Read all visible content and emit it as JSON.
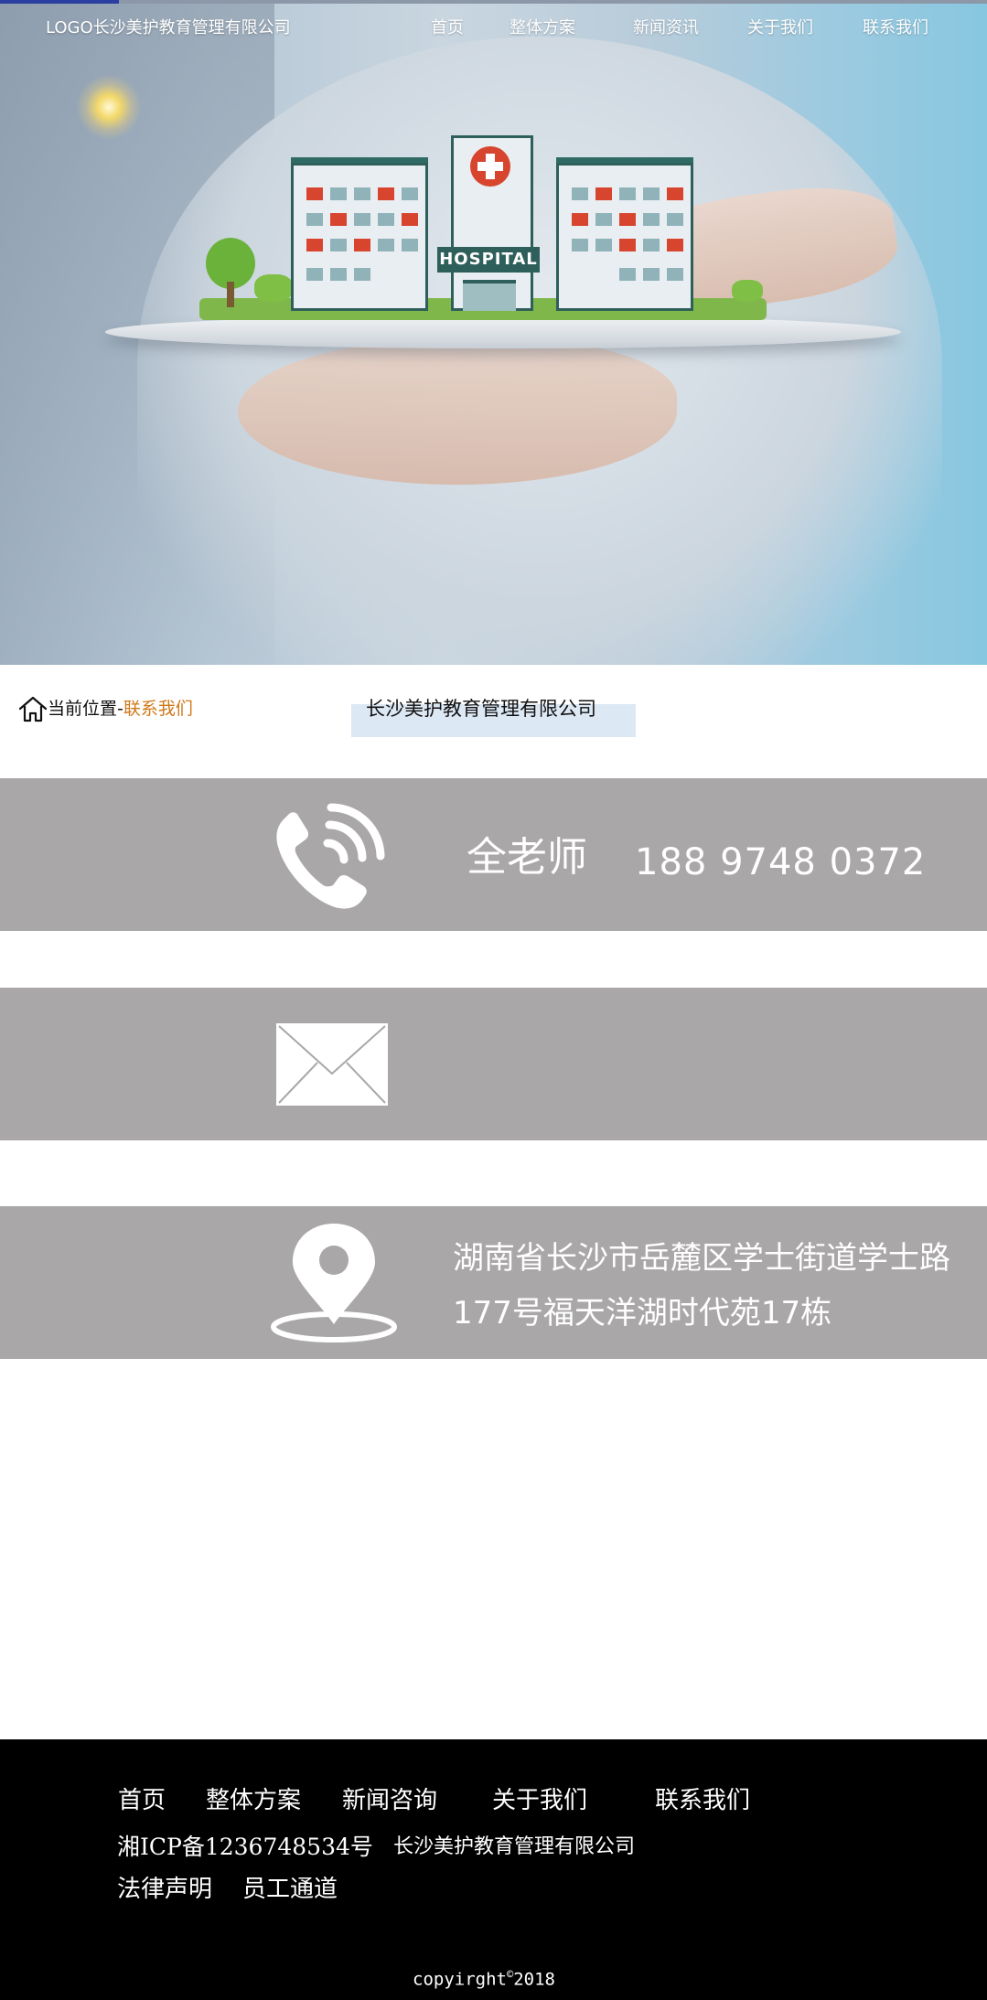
{
  "header": {
    "logo_text": "LOGO长沙美护教育管理有限公司",
    "nav": [
      "首页",
      "整体方案",
      "新闻资讯",
      "关于我们",
      "联系我们"
    ]
  },
  "hero": {
    "image_sign_text": "HOSPITAL"
  },
  "breadcrumb": {
    "prefix": "当前位置-",
    "current": "联系我们",
    "company_title": "长沙美护教育管理有限公司"
  },
  "contact": {
    "name": "全老师",
    "phone": "188 9748 0372",
    "address_line1": "湖南省长沙市岳麓区学士街道学士路",
    "address_line2": "177号福天洋湖时代苑17栋"
  },
  "footer": {
    "links": [
      "首页",
      "整体方案",
      "新闻咨询",
      "关于我们",
      "联系我们"
    ],
    "icp": "湘ICP备1236748534号",
    "company": "长沙美护教育管理有限公司",
    "legal": "法律声明",
    "staff": "员工通道",
    "copyright_text": "copyirght",
    "copyright_symbol": "©",
    "copyright_year": "2018"
  },
  "colors": {
    "band_gray": "#aaa7a8",
    "breadcrumb_current": "#d07818",
    "footer_bg": "#000000",
    "company_chip_bg": "#dde8f5"
  },
  "icons": [
    "home-icon",
    "phone-icon",
    "mail-icon",
    "location-pin-icon"
  ]
}
